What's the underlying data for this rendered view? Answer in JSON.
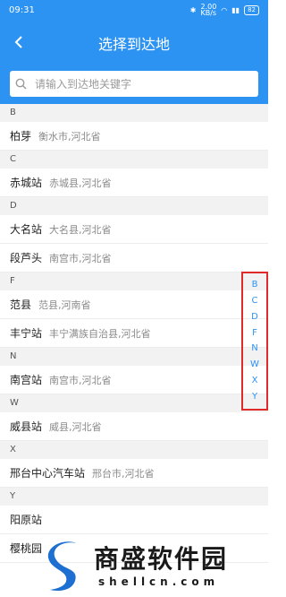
{
  "status": {
    "time": "09:31",
    "network_speed": "2.00\nKB/s",
    "battery": "82"
  },
  "header": {
    "title": "选择到达地"
  },
  "search": {
    "placeholder": "请输入到达地关键字"
  },
  "sections": [
    {
      "letter": "B",
      "items": [
        {
          "name": "柏芽",
          "region": "衡水市,河北省"
        }
      ]
    },
    {
      "letter": "C",
      "items": [
        {
          "name": "赤城站",
          "region": "赤城县,河北省"
        }
      ]
    },
    {
      "letter": "D",
      "items": [
        {
          "name": "大名站",
          "region": "大名县,河北省"
        },
        {
          "name": "段芦头",
          "region": "南宫市,河北省"
        }
      ]
    },
    {
      "letter": "F",
      "items": [
        {
          "name": "范县",
          "region": "范县,河南省"
        },
        {
          "name": "丰宁站",
          "region": "丰宁满族自治县,河北省"
        }
      ]
    },
    {
      "letter": "N",
      "items": [
        {
          "name": "南宫站",
          "region": "南宫市,河北省"
        }
      ]
    },
    {
      "letter": "W",
      "items": [
        {
          "name": "威县站",
          "region": "威县,河北省"
        }
      ]
    },
    {
      "letter": "X",
      "items": [
        {
          "name": "邢台中心汽车站",
          "region": "邢台市,河北省"
        }
      ]
    },
    {
      "letter": "Y",
      "items": [
        {
          "name": "阳原站",
          "region": ""
        },
        {
          "name": "樱桃园",
          "region": ""
        }
      ]
    }
  ],
  "index_letters": [
    "B",
    "C",
    "D",
    "F",
    "N",
    "W",
    "X",
    "Y"
  ],
  "watermark": {
    "text": "商盛软件园",
    "url": "shellcn.com"
  },
  "colors": {
    "accent": "#2c93f3",
    "highlight_border": "#e02a2a",
    "section_bg": "#f2f2f2"
  }
}
